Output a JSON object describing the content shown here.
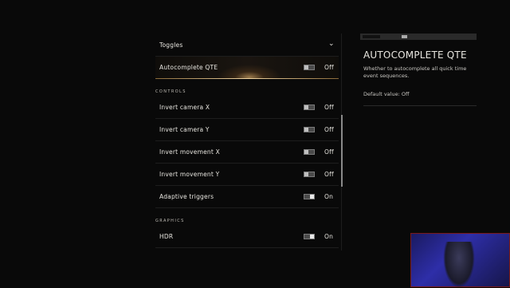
{
  "list": {
    "toggles_header": "Toggles",
    "rows_toggles": [
      {
        "label": "Autocomplete QTE",
        "value": "Off",
        "state": "off",
        "selected": true
      }
    ],
    "section_controls": "CONTROLS",
    "rows_controls": [
      {
        "label": "Invert camera X",
        "value": "Off",
        "state": "off"
      },
      {
        "label": "Invert camera Y",
        "value": "Off",
        "state": "off"
      },
      {
        "label": "Invert movement X",
        "value": "Off",
        "state": "off"
      },
      {
        "label": "Invert movement Y",
        "value": "Off",
        "state": "off"
      },
      {
        "label": "Adaptive triggers",
        "value": "On",
        "state": "on"
      }
    ],
    "section_graphics": "GRAPHICS",
    "rows_graphics": [
      {
        "label": "HDR",
        "value": "On",
        "state": "on"
      }
    ]
  },
  "panel": {
    "title": "AUTOCOMPLETE QTE",
    "description": "Whether to autocomplete all quick time event sequences.",
    "default_value": "Default value: Off"
  },
  "colors": {
    "accent": "#f3d7a3",
    "background": "#090909"
  }
}
